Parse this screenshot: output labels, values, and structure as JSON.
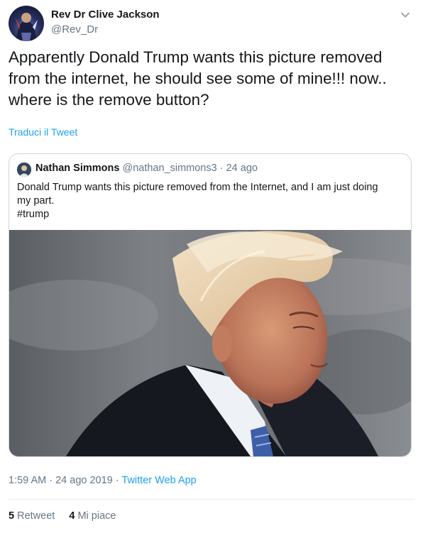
{
  "author": {
    "name": "Rev Dr Clive Jackson",
    "handle": "@Rev_Dr"
  },
  "tweet": {
    "lines": [
      "Apparently Donald Trump wants this picture removed",
      "from the internet, he should see some of mine!!! now..",
      "where is the remove button?"
    ],
    "translate_label": "Traduci il Tweet"
  },
  "quote": {
    "name": "Nathan Simmons",
    "handle": "@nathan_simmons3",
    "separator": "·",
    "time": "24 ago",
    "lines": [
      "Donald Trump wants this picture removed from the Internet, and I am just doing",
      "my part.",
      "#trump"
    ]
  },
  "meta": {
    "time": "1:59 AM",
    "date": "24 ago 2019",
    "separator": "·",
    "app": "Twitter Web App"
  },
  "stats": {
    "retweets_count": "5",
    "retweets_label": "Retweet",
    "likes_count": "4",
    "likes_label": "Mi piace"
  },
  "icons": {
    "menu": "chevron-down-icon"
  },
  "colors": {
    "link": "#1da1f2",
    "secondary_text": "#657786",
    "border": "#ccd6dd"
  }
}
